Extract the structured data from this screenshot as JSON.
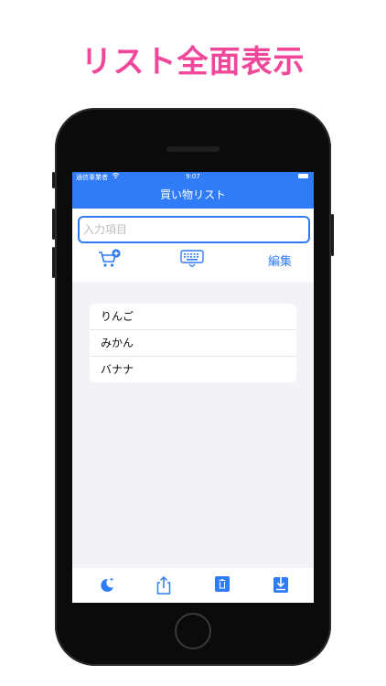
{
  "promo": {
    "title": "リスト全面表示"
  },
  "status": {
    "carrier": "通信事業者",
    "time": "9:07"
  },
  "nav": {
    "title": "買い物リスト"
  },
  "input": {
    "placeholder": "入力項目",
    "value": ""
  },
  "toolbar": {
    "edit_label": "編集"
  },
  "list": {
    "items": [
      "りんご",
      "みかん",
      "バナナ"
    ]
  },
  "colors": {
    "accent": "#2f7cf6",
    "promo": "#f0479a",
    "background": "#f2f2f7"
  },
  "icons": {
    "top": [
      "cart-add-icon",
      "keyboard-icon"
    ],
    "bottom": [
      "dark-mode-icon",
      "share-icon",
      "trash-icon",
      "download-icon"
    ]
  }
}
